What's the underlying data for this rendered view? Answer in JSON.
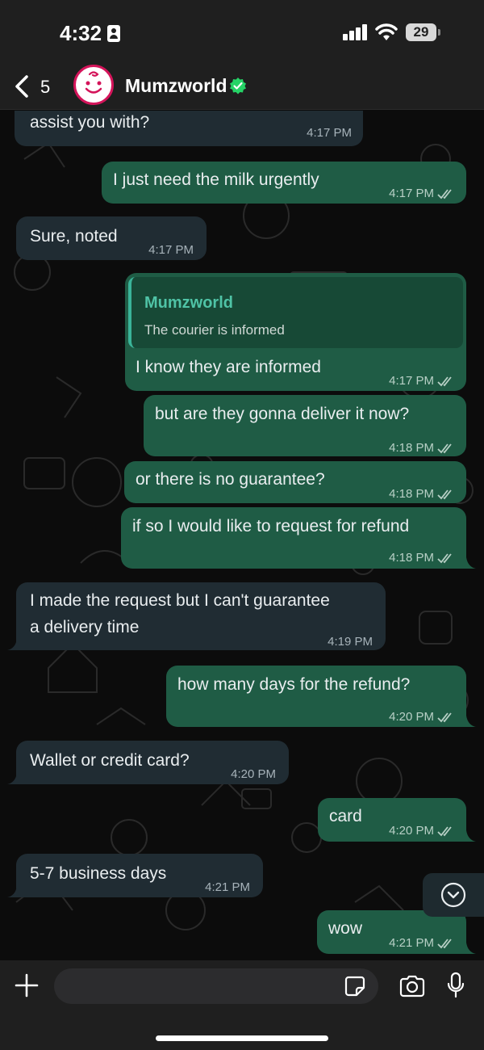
{
  "status_bar": {
    "time": "4:32",
    "battery": "29"
  },
  "header": {
    "back_count": "5",
    "contact_name": "Mumzworld"
  },
  "messages": [
    {
      "id": "m1",
      "direction": "in",
      "lines": [
        "assist you with?"
      ],
      "time": "4:17 PM"
    },
    {
      "id": "m2",
      "direction": "out",
      "lines": [
        "I just need the milk urgently"
      ],
      "time": "4:17 PM"
    },
    {
      "id": "m3",
      "direction": "in",
      "lines": [
        "Sure, noted"
      ],
      "time": "4:17 PM"
    },
    {
      "id": "m4",
      "direction": "out",
      "quote": {
        "name": "Mumzworld",
        "text": "The courier is informed"
      },
      "lines": [
        "I know they are informed"
      ],
      "time": "4:17 PM"
    },
    {
      "id": "m5",
      "direction": "out",
      "lines": [
        "but are they gonna deliver it now?"
      ],
      "time": "4:18 PM"
    },
    {
      "id": "m6",
      "direction": "out",
      "lines": [
        "or there is no guarantee?"
      ],
      "time": "4:18 PM"
    },
    {
      "id": "m7",
      "direction": "out",
      "lines": [
        "if so I would like to request for refund"
      ],
      "time": "4:18 PM"
    },
    {
      "id": "m8",
      "direction": "in",
      "lines": [
        "I made the request but I can't guarantee",
        "a delivery time"
      ],
      "time": "4:19 PM"
    },
    {
      "id": "m9",
      "direction": "out",
      "lines": [
        "how many days for the refund?"
      ],
      "time": "4:20 PM"
    },
    {
      "id": "m10",
      "direction": "in",
      "lines": [
        "Wallet or credit card?"
      ],
      "time": "4:20 PM"
    },
    {
      "id": "m11",
      "direction": "out",
      "lines": [
        "card"
      ],
      "time": "4:20 PM"
    },
    {
      "id": "m12",
      "direction": "in",
      "lines": [
        "5-7 business days"
      ],
      "time": "4:21 PM"
    },
    {
      "id": "m13",
      "direction": "out",
      "lines": [
        "wow"
      ],
      "time": "4:21 PM"
    }
  ],
  "input": {
    "placeholder": ""
  },
  "colors": {
    "incoming": "#202c33",
    "outgoing": "#1f5c45",
    "accent": "#25d366",
    "quote_accent": "#3ab499"
  }
}
